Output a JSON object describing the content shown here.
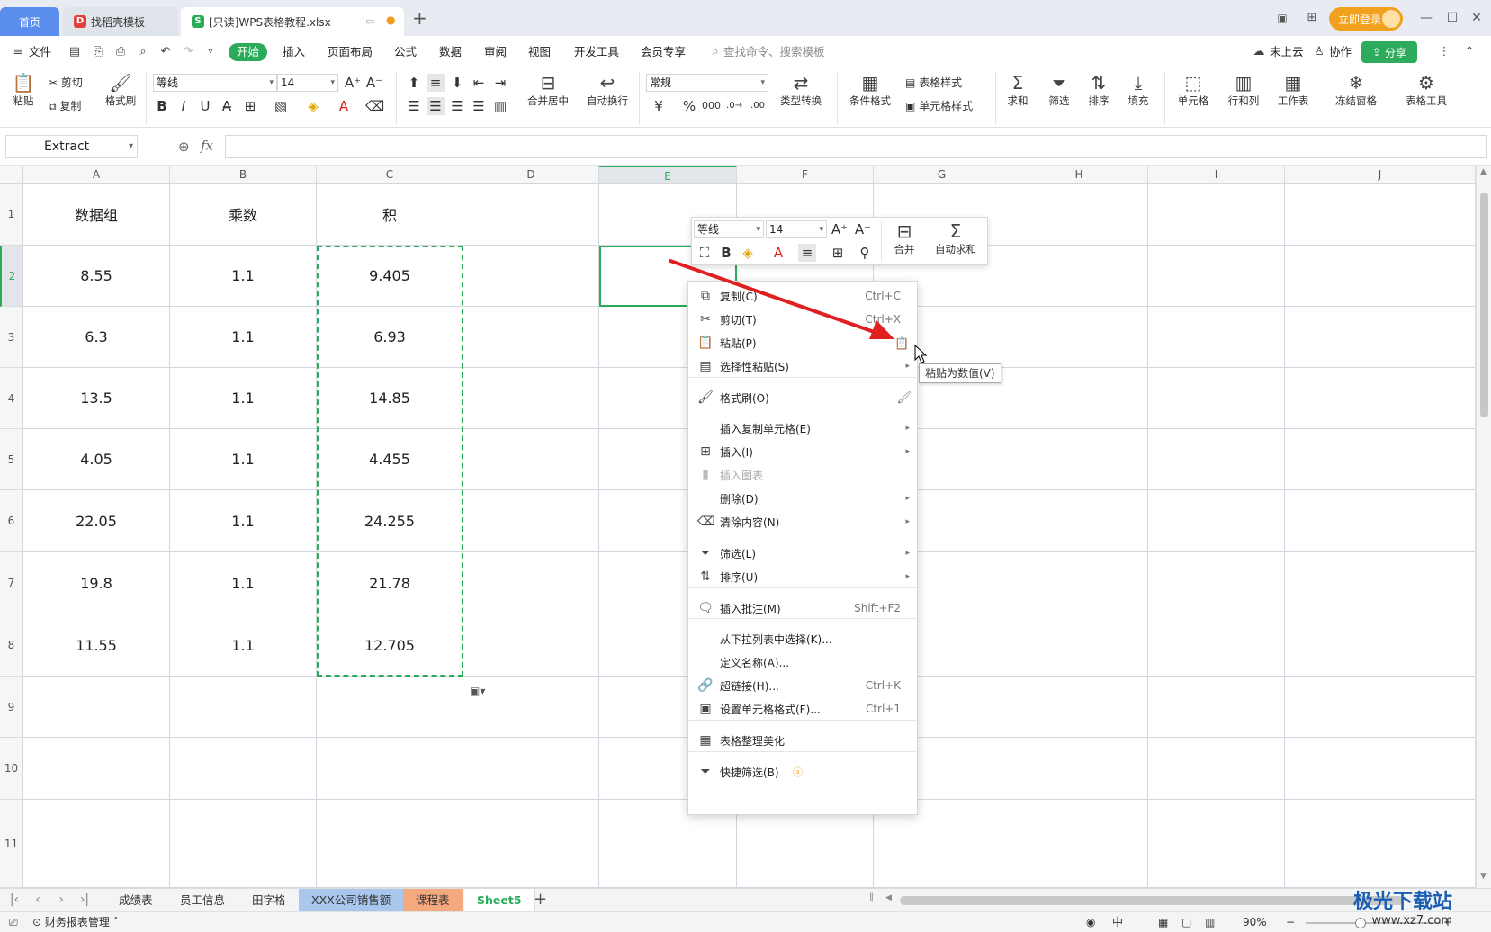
{
  "titlebar": {
    "tabs": [
      {
        "label": "首页"
      },
      {
        "label": "找稻壳模板"
      },
      {
        "label": "[只读]WPS表格教程.xlsx"
      }
    ],
    "login_label": "立即登录"
  },
  "menubar": {
    "file_label": "文件",
    "items": [
      "开始",
      "插入",
      "页面布局",
      "公式",
      "数据",
      "审阅",
      "视图",
      "开发工具",
      "会员专享"
    ],
    "search_placeholder": "查找命令、搜索模板",
    "cloud_label": "未上云",
    "collab_label": "协作",
    "share_label": "分享"
  },
  "ribbon": {
    "paste": "粘贴",
    "cut": "剪切",
    "copy": "复制",
    "format_painter": "格式刷",
    "font_name": "等线",
    "font_size": "14",
    "merge_center": "合并居中",
    "wrap_text": "自动换行",
    "number_format": "常规",
    "type_convert": "类型转换",
    "cond_format": "条件格式",
    "table_style": "表格样式",
    "cell_style": "单元格样式",
    "sum": "求和",
    "filter": "筛选",
    "sort": "排序",
    "fill": "填充",
    "cell": "单元格",
    "row_col": "行和列",
    "worksheet": "工作表",
    "freeze": "冻结窗格",
    "table_tools": "表格工具"
  },
  "formula_bar": {
    "name_box": "Extract",
    "fx_label": "fx",
    "value": ""
  },
  "sheet": {
    "columns": [
      "A",
      "B",
      "C",
      "D",
      "E",
      "F",
      "G",
      "H",
      "I",
      "J"
    ],
    "row_numbers": [
      "1",
      "2",
      "3",
      "4",
      "5",
      "6",
      "7",
      "8",
      "9",
      "10",
      "11"
    ],
    "header": [
      "数据组",
      "乘数",
      "积"
    ],
    "rows": [
      [
        "8.55",
        "1.1",
        "9.405"
      ],
      [
        "6.3",
        "1.1",
        "6.93"
      ],
      [
        "13.5",
        "1.1",
        "14.85"
      ],
      [
        "4.05",
        "1.1",
        "4.455"
      ],
      [
        "22.05",
        "1.1",
        "24.255"
      ],
      [
        "19.8",
        "1.1",
        "21.78"
      ],
      [
        "11.55",
        "1.1",
        "12.705"
      ]
    ],
    "active_cell": "E2"
  },
  "mini_toolbar": {
    "font_name": "等线",
    "font_size": "14",
    "merge": "合并",
    "autosum": "自动求和"
  },
  "context_menu": {
    "items": [
      {
        "label": "复制(C)",
        "shortcut": "Ctrl+C",
        "icon": "copy-icon"
      },
      {
        "label": "剪切(T)",
        "shortcut": "Ctrl+X",
        "icon": "scissors-icon"
      },
      {
        "label": "粘贴(P)",
        "shortcut": "",
        "icon": "paste-icon"
      },
      {
        "label": "选择性粘贴(S)",
        "shortcut": "",
        "icon": "paste-special-icon"
      },
      {
        "label": "格式刷(O)",
        "shortcut": "",
        "icon": "format-painter-icon"
      },
      {
        "label": "插入复制单元格(E)",
        "shortcut": "",
        "icon": ""
      },
      {
        "label": "插入(I)",
        "shortcut": "",
        "icon": "insert-icon"
      },
      {
        "label": "插入图表",
        "shortcut": "",
        "icon": "chart-icon"
      },
      {
        "label": "删除(D)",
        "shortcut": "",
        "icon": ""
      },
      {
        "label": "清除内容(N)",
        "shortcut": "",
        "icon": "eraser-icon"
      },
      {
        "label": "筛选(L)",
        "shortcut": "",
        "icon": "filter-icon"
      },
      {
        "label": "排序(U)",
        "shortcut": "",
        "icon": "sort-icon"
      },
      {
        "label": "插入批注(M)",
        "shortcut": "Shift+F2",
        "icon": "comment-icon"
      },
      {
        "label": "从下拉列表中选择(K)...",
        "shortcut": "",
        "icon": ""
      },
      {
        "label": "定义名称(A)...",
        "shortcut": "",
        "icon": ""
      },
      {
        "label": "超链接(H)...",
        "shortcut": "Ctrl+K",
        "icon": "link-icon"
      },
      {
        "label": "设置单元格格式(F)...",
        "shortcut": "Ctrl+1",
        "icon": "cell-format-icon"
      },
      {
        "label": "表格整理美化",
        "shortcut": "",
        "icon": "beautify-icon"
      },
      {
        "label": "快捷筛选(B)",
        "shortcut": "",
        "icon": "quick-filter-icon"
      }
    ],
    "tooltip": "粘贴为数值(V)"
  },
  "sheet_tabs": {
    "tabs": [
      "成绩表",
      "员工信息",
      "田字格",
      "XXX公司销售额",
      "课程表",
      "Sheet5"
    ],
    "active": "Sheet5",
    "tab_colors": {
      "XXX公司销售额": "#a9c6ec",
      "课程表": "#f4a97f"
    }
  },
  "status_bar": {
    "macro_label": "财务报表管理",
    "zoom": "90%"
  },
  "watermark": {
    "brand": "极光下载站",
    "url": "www.xz7.com"
  },
  "colors": {
    "accent_green": "#2cab5b",
    "home_tab": "#5b8def",
    "login_orange": "#f2a11f",
    "arrow_red": "#e02020"
  }
}
